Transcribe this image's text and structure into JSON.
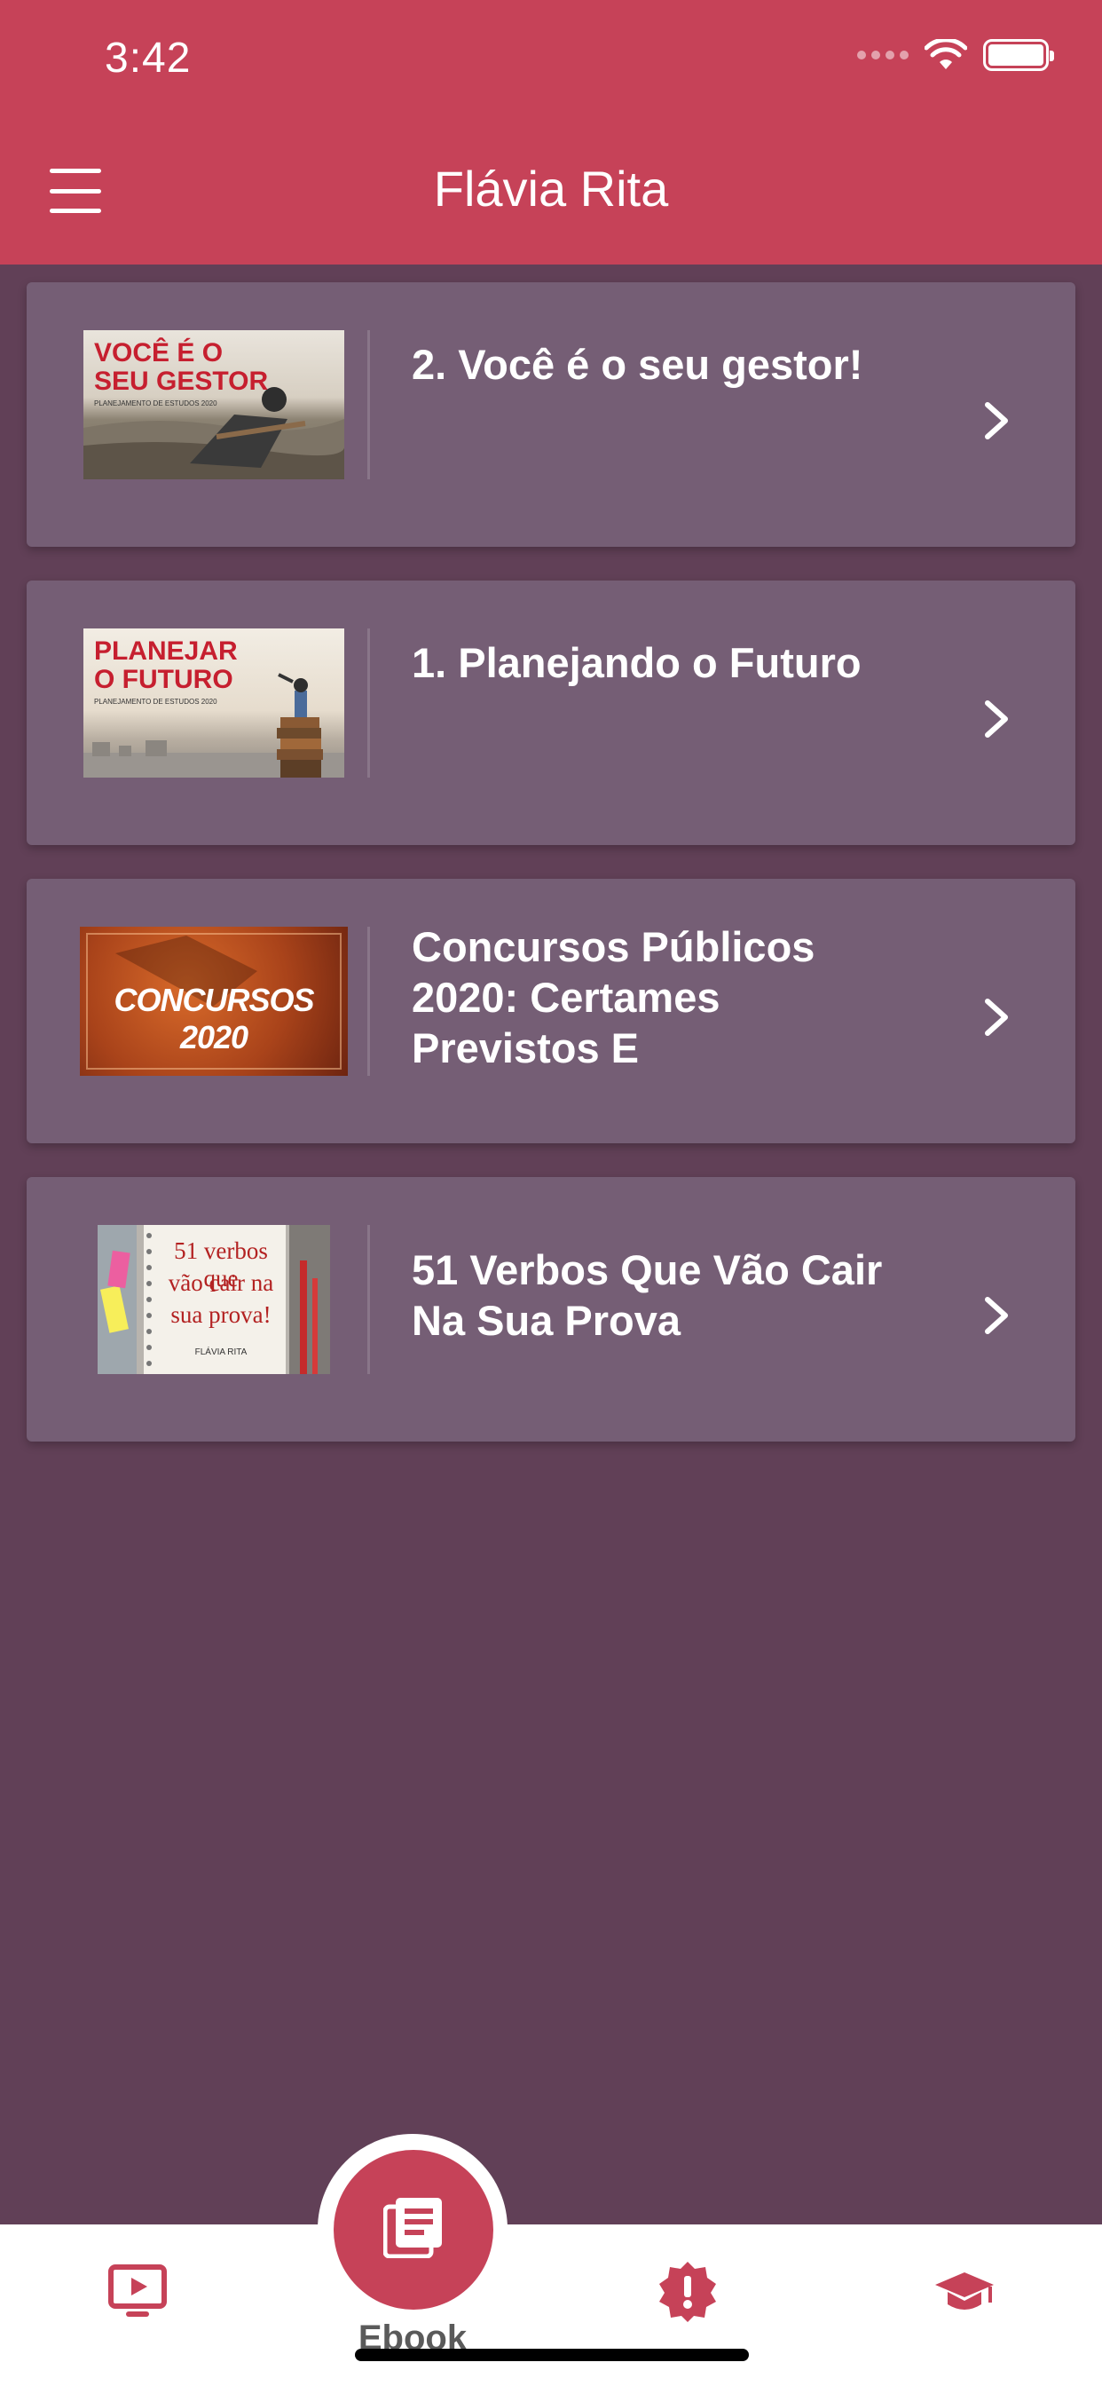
{
  "status_bar": {
    "time": "3:42"
  },
  "header": {
    "title": "Flávia Rita"
  },
  "cards": [
    {
      "title": "2. Você é o seu gestor!",
      "thumb_line1": "VOCÊ É O",
      "thumb_line2": "SEU GESTOR",
      "thumb_sub": "PLANEJAMENTO DE ESTUDOS 2020"
    },
    {
      "title": "1. Planejando o Futuro",
      "thumb_line1": "PLANEJAR",
      "thumb_line2": "O FUTURO",
      "thumb_sub": "PLANEJAMENTO DE ESTUDOS 2020"
    },
    {
      "title": "Concursos Públicos 2020: Certames Previstos E",
      "thumb_text": "CONCURSOS 2020"
    },
    {
      "title": "51 Verbos Que Vão Cair Na Sua Prova",
      "thumb_line1": "51 verbos que",
      "thumb_line2": "vão cair na",
      "thumb_line3": "sua prova!",
      "thumb_brand": "FLÁVIA RITA"
    }
  ],
  "tabbar": {
    "active_label": "Ebook",
    "accent_color": "#c64258",
    "icons": [
      "video-icon",
      "ebook-icon",
      "alert-icon",
      "graduation-cap-icon"
    ]
  },
  "colors": {
    "header": "#c64258",
    "background": "#614057",
    "card": "#755e75"
  }
}
